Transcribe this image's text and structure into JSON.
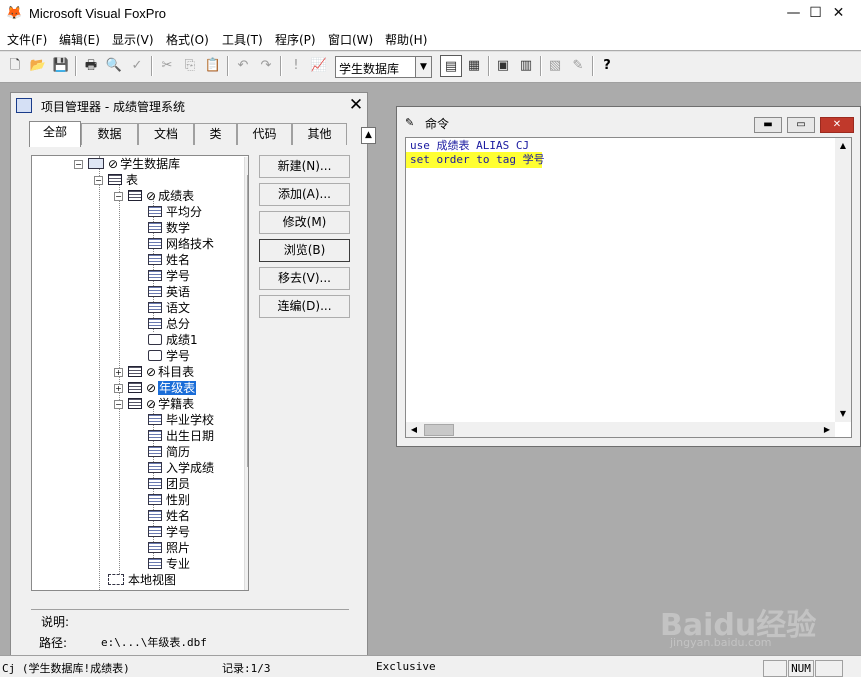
{
  "window": {
    "title": "Microsoft Visual FoxPro",
    "minimize": "—",
    "maximize": "☐",
    "close": "✕"
  },
  "menu": [
    {
      "label": "文件(F)"
    },
    {
      "label": "编辑(E)"
    },
    {
      "label": "显示(V)"
    },
    {
      "label": "格式(O)"
    },
    {
      "label": "工具(T)"
    },
    {
      "label": "程序(P)"
    },
    {
      "label": "窗口(W)"
    },
    {
      "label": "帮助(H)"
    }
  ],
  "toolbar": {
    "database_combo_value": "学生数据库"
  },
  "project_manager": {
    "title": "项目管理器 - 成绩管理系统",
    "tabs": [
      {
        "label": "全部"
      },
      {
        "label": "数据"
      },
      {
        "label": "文档"
      },
      {
        "label": "类"
      },
      {
        "label": "代码"
      },
      {
        "label": "其他"
      }
    ],
    "active_tab": "全部",
    "tree": {
      "database": "学生数据库",
      "tables_group": "表",
      "table1": {
        "name": "成绩表",
        "fields": [
          "平均分",
          "数学",
          "网络技术",
          "姓名",
          "学号",
          "英语",
          "语文",
          "总分"
        ],
        "indexes": [
          "成绩1",
          "学号"
        ]
      },
      "table2": {
        "name": "科目表"
      },
      "table3": {
        "name": "年级表"
      },
      "table4": {
        "name": "学籍表",
        "fields": [
          "毕业学校",
          "出生日期",
          "简历",
          "入学成绩",
          "团员",
          "性别",
          "姓名",
          "学号",
          "照片",
          "专业"
        ]
      },
      "views_group": "本地视图"
    },
    "buttons": [
      "新建(N)...",
      "添加(A)...",
      "修改(M)",
      "浏览(B)",
      "移去(V)...",
      "连编(D)..."
    ],
    "description_label": "说明:",
    "path_label": "路径:",
    "path_value": "e:\\...\\年级表.dbf"
  },
  "command_window": {
    "title": "命令",
    "lines": [
      "use 成绩表 ALIAS CJ",
      "set order to tag 学号"
    ]
  },
  "status_bar": {
    "alias": "Cj (学生数据库!成绩表)",
    "record": "记录:1/3",
    "mode": "Exclusive",
    "num": "NUM"
  },
  "watermark": {
    "text": "Baidu经验",
    "sub": "jingyan.baidu.com"
  }
}
